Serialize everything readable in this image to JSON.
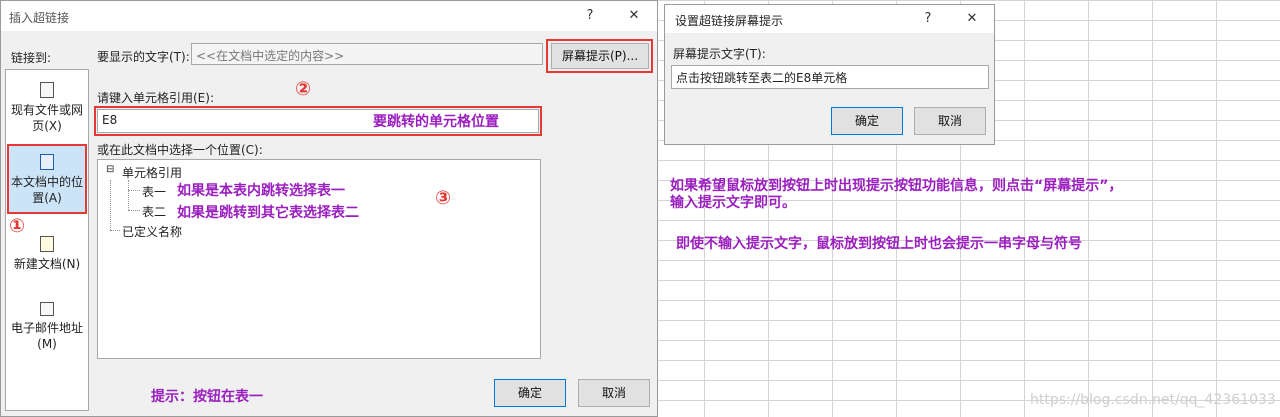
{
  "main_dialog": {
    "title": "插入超链接",
    "help_glyph": "?",
    "close_glyph": "✕",
    "link_to_label": "链接到:",
    "display_text_label": "要显示的文字(T):",
    "display_text_value": "<<在文档中选定的内容>>",
    "screentip_button": "屏幕提示(P)...",
    "cell_ref_label": "请键入单元格引用(E):",
    "cell_ref_value": "E8",
    "choose_place_label": "或在此文档中选择一个位置(C):",
    "tree": {
      "root": "单元格引用",
      "sheet1": "表一",
      "sheet2": "表二",
      "defined_names": "已定义名称",
      "expand_glyph": "⊟"
    },
    "link_items": [
      {
        "label": "现有文件或网页(X)"
      },
      {
        "label": "本文档中的位置(A)"
      },
      {
        "label": "新建文档(N)"
      },
      {
        "label": "电子邮件地址(M)"
      }
    ],
    "ok_button": "确定",
    "cancel_button": "取消"
  },
  "screentip_dialog": {
    "title": "设置超链接屏幕提示",
    "help_glyph": "?",
    "close_glyph": "✕",
    "text_label": "屏幕提示文字(T):",
    "text_value": "点击按钮跳转至表二的E8单元格",
    "ok_button": "确定",
    "cancel_button": "取消"
  },
  "annotations": {
    "marker1": "①",
    "marker2": "②",
    "marker3": "③",
    "cell_position_note": "要跳转的单元格位置",
    "sheet1_note": "如果是本表内跳转选择表一",
    "sheet2_note": "如果是跳转到其它表选择表二",
    "button_note": "提示：按钮在表一",
    "tip_note_line1": "如果希望鼠标放到按钮上时出现提示按钮功能信息，则点击“屏幕提示”，",
    "tip_note_line2": "输入提示文字即可。",
    "tip_note_line3": "即使不输入提示文字，鼠标放到按钮上时也会提示一串字母与符号"
  },
  "watermark": "https://blog.csdn.net/qq_42361033",
  "colors": {
    "annotation_purple": "#9b1fbf",
    "highlight_red": "#e53935",
    "selected_blue": "#cce4f7"
  }
}
